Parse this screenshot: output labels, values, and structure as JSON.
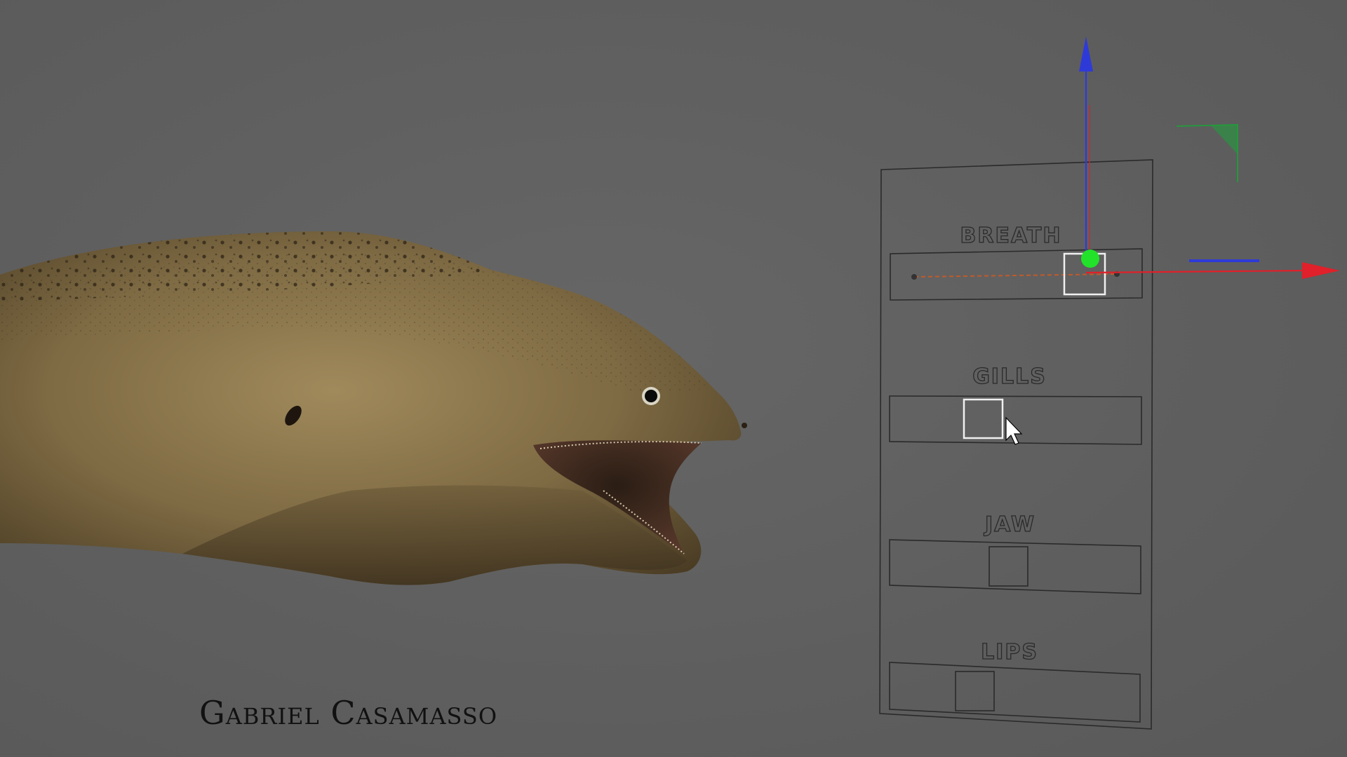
{
  "credit": {
    "name": "Gabriel Casamasso"
  },
  "control_panel": {
    "sliders": [
      {
        "label": "BREATH",
        "value": 0.76
      },
      {
        "label": "GILLS",
        "value": 0.32
      },
      {
        "label": "JAW",
        "value": 0.52
      },
      {
        "label": "LIPS",
        "value": 0.34
      }
    ]
  },
  "gizmo": {
    "x_axis_color": "#e0202a",
    "y_axis_color": "#2e3ad8",
    "z_axis_color": "#1f9e3a",
    "handle_color": "#22e22a"
  },
  "icons": {
    "cursor": "mouse-pointer-icon",
    "model": "moray-eel-3d-model"
  }
}
